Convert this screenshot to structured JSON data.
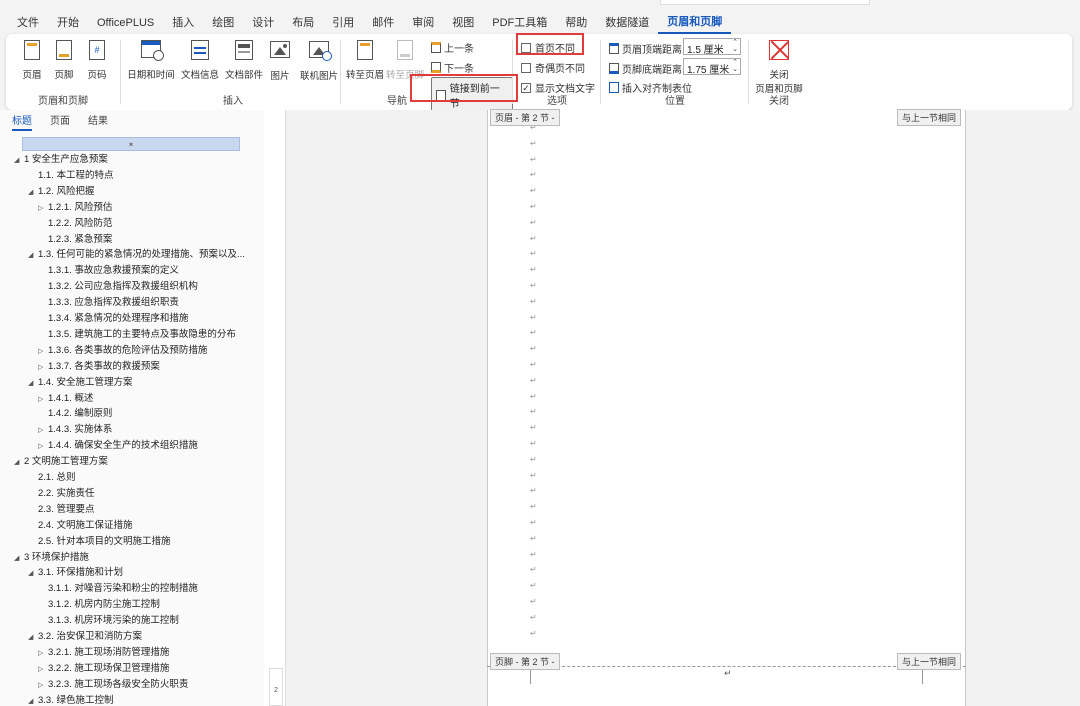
{
  "menu": {
    "tabs": [
      "文件",
      "开始",
      "OfficePLUS",
      "插入",
      "绘图",
      "设计",
      "布局",
      "引用",
      "邮件",
      "审阅",
      "视图",
      "PDF工具箱",
      "帮助",
      "数据隧道",
      "页眉和页脚"
    ],
    "active_tab": "页眉和页脚"
  },
  "ribbon": {
    "groups": {
      "header_footer": {
        "label": "页眉和页脚",
        "header": "页眉",
        "footer": "页脚",
        "page_number": "页码"
      },
      "insert": {
        "label": "插入",
        "date_time": "日期和时间",
        "doc_info": "文档信息",
        "doc_parts": "文档部件",
        "picture": "图片",
        "online_picture": "联机图片"
      },
      "navigation": {
        "label": "导航",
        "goto_header": "转至页眉",
        "goto_footer": "转至页脚",
        "previous": "上一条",
        "next": "下一条",
        "link_to_previous": "链接到前一节"
      },
      "options": {
        "label": "选项",
        "different_first_page": "首页不同",
        "different_odd_even": "奇偶页不同",
        "show_document_text": "显示文档文字",
        "show_document_text_checked": true
      },
      "position": {
        "label": "位置",
        "header_from_top": "页眉顶端距离:",
        "header_from_top_value": "1.5 厘米",
        "footer_from_bottom": "页脚底端距离:",
        "footer_from_bottom_value": "1.75 厘米",
        "insert_alignment_tab": "插入对齐制表位"
      },
      "close": {
        "label": "关闭",
        "button": "关闭\n页眉和页脚",
        "button_line1": "关闭",
        "button_line2": "页眉和页脚"
      }
    }
  },
  "nav": {
    "tabs": [
      "标题",
      "页面",
      "结果"
    ],
    "active_tab": "标题",
    "top_glyph": "⌅",
    "items": [
      {
        "text": "1 安全生产应急预案",
        "level": 0,
        "toggle": "◢"
      },
      {
        "text": "1.1. 本工程的特点",
        "level": 1,
        "toggle": ""
      },
      {
        "text": "1.2. 风险把握",
        "level": 1,
        "toggle": "◢"
      },
      {
        "text": "1.2.1. 风险预估",
        "level": 2,
        "toggle": "▷"
      },
      {
        "text": "1.2.2. 风险防范",
        "level": 2,
        "toggle": ""
      },
      {
        "text": "1.2.3. 紧急预案",
        "level": 2,
        "toggle": ""
      },
      {
        "text": "1.3. 任何可能的紧急情况的处理措施、预案以及...",
        "level": 1,
        "toggle": "◢"
      },
      {
        "text": "1.3.1. 事故应急救援预案的定义",
        "level": 2,
        "toggle": ""
      },
      {
        "text": "1.3.2. 公司应急指挥及救援组织机构",
        "level": 2,
        "toggle": ""
      },
      {
        "text": "1.3.3. 应急指挥及救援组织职责",
        "level": 2,
        "toggle": ""
      },
      {
        "text": "1.3.4. 紧急情况的处理程序和措施",
        "level": 2,
        "toggle": ""
      },
      {
        "text": "1.3.5. 建筑施工的主要特点及事故隐患的分布",
        "level": 2,
        "toggle": ""
      },
      {
        "text": "1.3.6. 各类事故的危险评估及预防措施",
        "level": 2,
        "toggle": "▷"
      },
      {
        "text": "1.3.7. 各类事故的救援预案",
        "level": 2,
        "toggle": "▷"
      },
      {
        "text": "1.4. 安全施工管理方案",
        "level": 1,
        "toggle": "◢"
      },
      {
        "text": "1.4.1. 概述",
        "level": 2,
        "toggle": "▷"
      },
      {
        "text": "1.4.2. 编制原则",
        "level": 2,
        "toggle": ""
      },
      {
        "text": "1.4.3. 实施体系",
        "level": 2,
        "toggle": "▷"
      },
      {
        "text": "1.4.4. 确保安全生产的技术组织措施",
        "level": 2,
        "toggle": "▷"
      },
      {
        "text": "2 文明施工管理方案",
        "level": 0,
        "toggle": "◢"
      },
      {
        "text": "2.1. 总则",
        "level": 1,
        "toggle": ""
      },
      {
        "text": "2.2. 实施责任",
        "level": 1,
        "toggle": ""
      },
      {
        "text": "2.3. 管理要点",
        "level": 1,
        "toggle": ""
      },
      {
        "text": "2.4. 文明施工保证措施",
        "level": 1,
        "toggle": ""
      },
      {
        "text": "2.5. 针对本项目的文明施工措施",
        "level": 1,
        "toggle": ""
      },
      {
        "text": "3 环境保护措施",
        "level": 0,
        "toggle": "◢"
      },
      {
        "text": "3.1. 环保措施和计划",
        "level": 1,
        "toggle": "◢"
      },
      {
        "text": "3.1.1. 对噪音污染和粉尘的控制措施",
        "level": 2,
        "toggle": ""
      },
      {
        "text": "3.1.2. 机房内防尘施工控制",
        "level": 2,
        "toggle": ""
      },
      {
        "text": "3.1.3. 机房环境污染的施工控制",
        "level": 2,
        "toggle": ""
      },
      {
        "text": "3.2. 治安保卫和消防方案",
        "level": 1,
        "toggle": "◢"
      },
      {
        "text": "3.2.1. 施工现场消防管理措施",
        "level": 2,
        "toggle": "▷"
      },
      {
        "text": "3.2.2. 施工现场保卫管理措施",
        "level": 2,
        "toggle": "▷"
      },
      {
        "text": "3.2.3. 施工现场各级安全防火职责",
        "level": 2,
        "toggle": "▷"
      },
      {
        "text": "3.3. 绿色施工控制",
        "level": 1,
        "toggle": "◢"
      }
    ]
  },
  "document": {
    "header_tag": "页眉 - 第 2 节 -",
    "header_link_tag": "与上一节相同",
    "footer_tag": "页脚 - 第 2 节 -",
    "footer_link_tag": "与上一节相同",
    "paragraph_mark": "↵",
    "page_number_side": "2"
  }
}
